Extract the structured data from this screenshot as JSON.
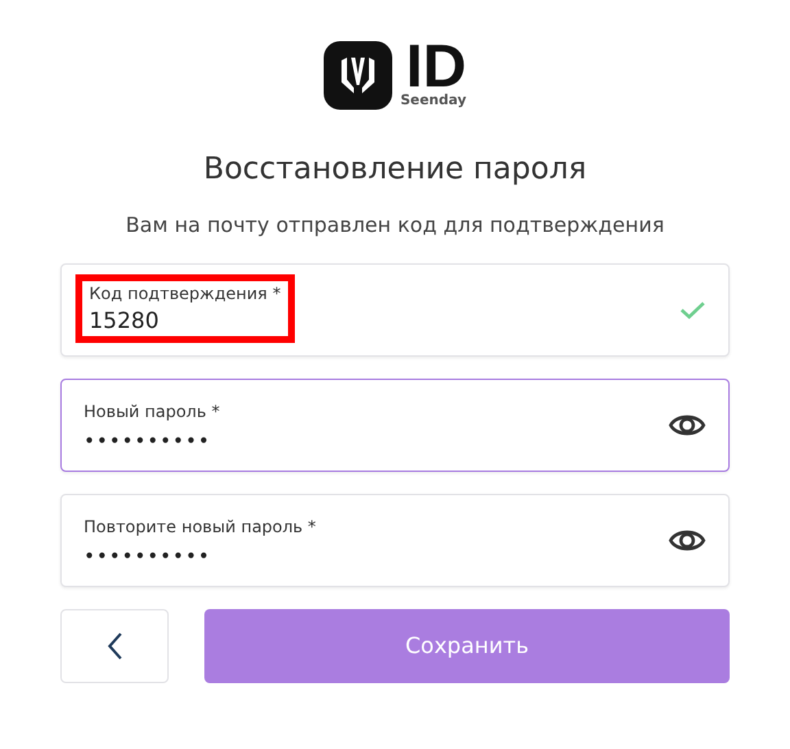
{
  "logo": {
    "mark": "ID",
    "name": "Seenday"
  },
  "title": "Восстановление пароля",
  "subtitle": "Вам на почту отправлен код для подтверждения",
  "fields": [
    {
      "kind": "code",
      "label": "Код подтверждения *",
      "value": "15280",
      "valid": true,
      "focused": false,
      "highlighted": true
    },
    {
      "kind": "password",
      "label": "Новый пароль *",
      "value": "••••••••••",
      "focused": true
    },
    {
      "kind": "password",
      "label": "Повторите новый пароль *",
      "value": "••••••••••",
      "focused": false
    }
  ],
  "save_button": "Сохранить"
}
